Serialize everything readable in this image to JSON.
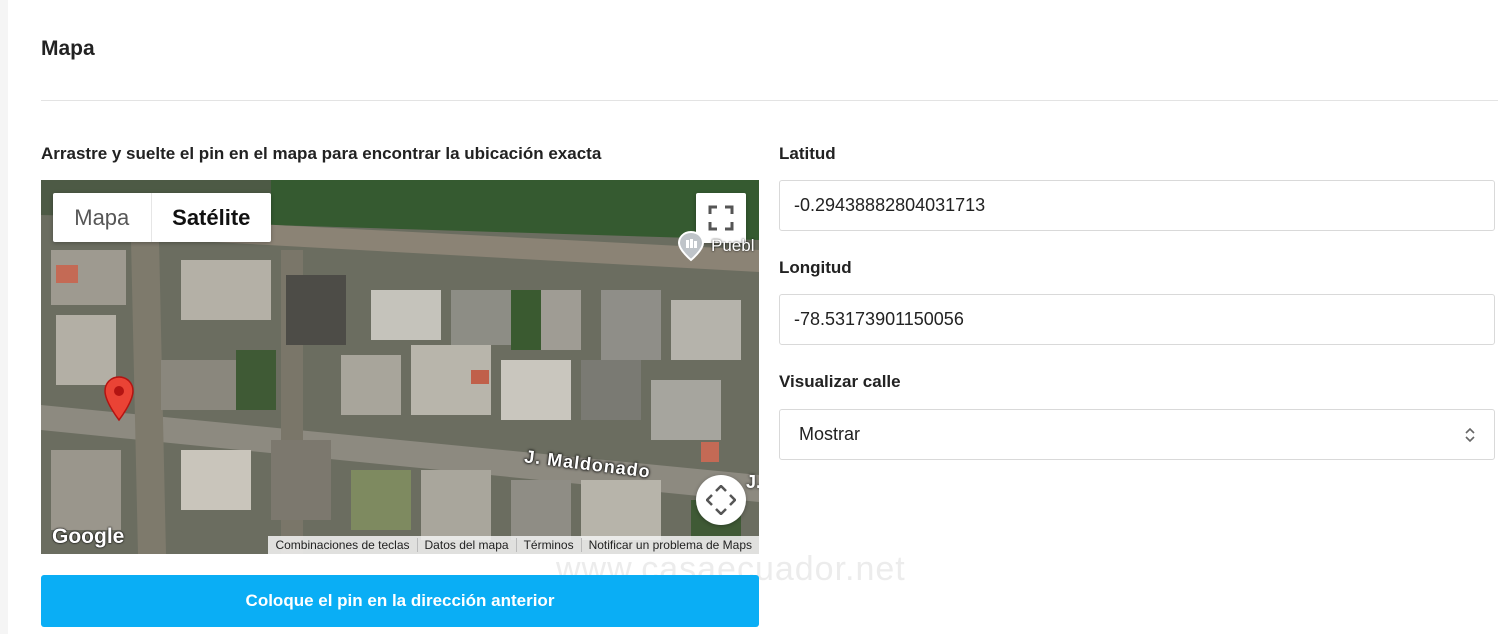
{
  "section": {
    "title": "Mapa",
    "map_instruction": "Arrastre y suelte el pin en el mapa para encontrar la ubicación exacta"
  },
  "map": {
    "type_map_label": "Mapa",
    "type_satellite_label": "Satélite",
    "selected_type": "Satélite",
    "poi_label": "Puebl",
    "street_label": "J. Maldonado",
    "street_label_2": "J.",
    "logo_text": "Google",
    "attribution": [
      "Combinaciones de teclas",
      "Datos del mapa",
      "Términos",
      "Notificar un problema de Maps"
    ],
    "icons": [
      "fullscreen-icon",
      "pan-control-icon",
      "map-pin-icon",
      "poi-icon"
    ]
  },
  "form": {
    "latitude_label": "Latitud",
    "latitude_value": "-0.29438882804031713",
    "longitude_label": "Longitud",
    "longitude_value": "-78.53173901150056",
    "street_view_label": "Visualizar calle",
    "street_view_value": "Mostrar"
  },
  "actions": {
    "place_pin_label": "Coloque el pin en la dirección anterior"
  },
  "watermark": "www.casaecuador.net",
  "colors": {
    "primary_button": "#0aaef5",
    "pin": "#ea4335"
  }
}
